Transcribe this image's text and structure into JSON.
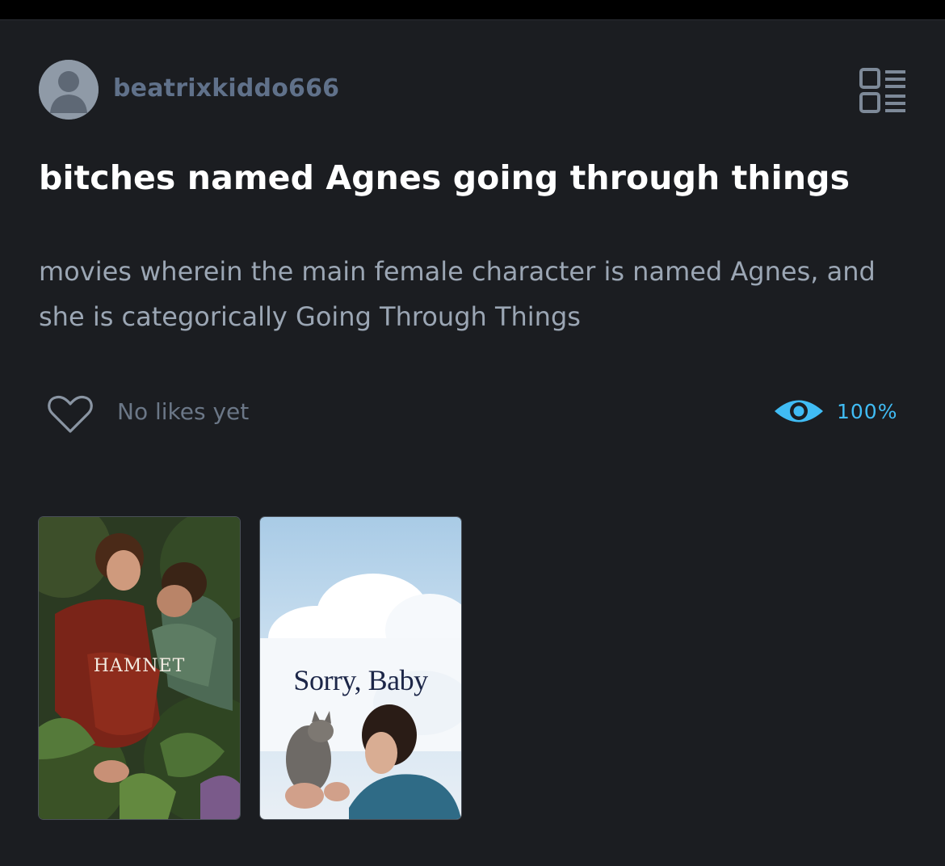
{
  "list": {
    "author": "beatrixkiddo666",
    "title": "bitches named Agnes going through things",
    "description": "movies wherein the main female character is named Agnes, and she is categorically Going Through Things"
  },
  "stats": {
    "likes_text": "No likes yet",
    "watched_percent": "100%"
  },
  "icons": {
    "avatar": "default-user-icon",
    "view_toggle": "grid-list-view-icon",
    "like": "heart-outline-icon",
    "watched": "eye-icon"
  },
  "posters": [
    {
      "title": "HAMNET"
    },
    {
      "title": "Sorry, Baby"
    }
  ],
  "colors": {
    "background": "#1b1d21",
    "title": "#ffffff",
    "username": "#60718a",
    "accent": "#40bcf4"
  }
}
